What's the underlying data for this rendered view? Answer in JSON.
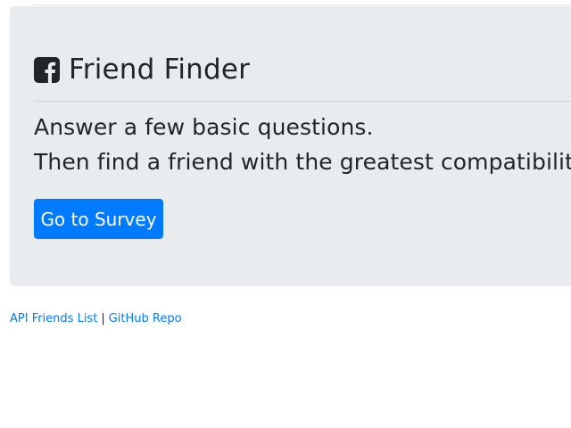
{
  "jumbotron": {
    "title": "Friend Finder",
    "icon": "facebook-square-icon",
    "lead_line_1": "Answer a few basic questions.",
    "lead_line_2": "Then find a friend with the greatest compatibility!",
    "button_label": "Go to Survey"
  },
  "footer": {
    "link_1": "API Friends List",
    "separator": "|",
    "link_2": "GitHub Repo"
  },
  "colors": {
    "jumbotron_bg": "#e9ecef",
    "primary": "#007bff",
    "text": "#212529"
  }
}
